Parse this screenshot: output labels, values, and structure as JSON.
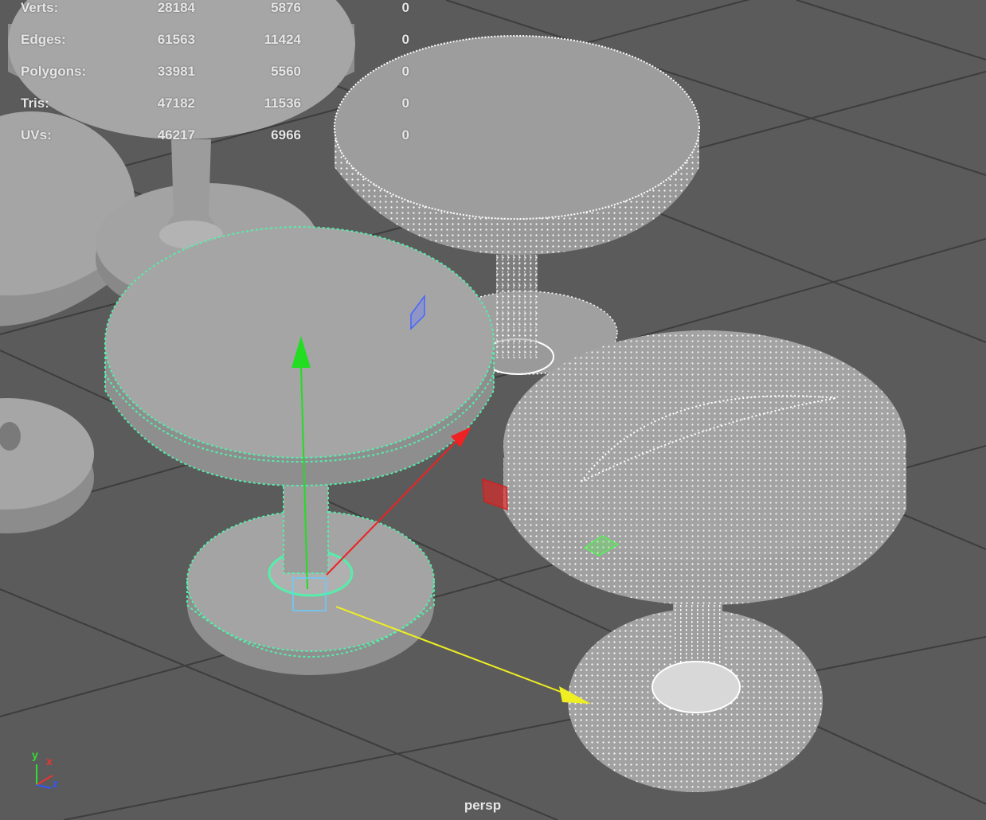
{
  "viewport": {
    "camera": "persp",
    "background": "#5b5b5b",
    "grid_color": "#3d3d3d"
  },
  "heads_up_display": {
    "rows": [
      {
        "label": "Verts:",
        "values": [
          "28184",
          "5876",
          "0"
        ]
      },
      {
        "label": "Edges:",
        "values": [
          "61563",
          "11424",
          "0"
        ]
      },
      {
        "label": "Polygons:",
        "values": [
          "33981",
          "5560",
          "0"
        ]
      },
      {
        "label": "Tris:",
        "values": [
          "47182",
          "11536",
          "0"
        ]
      },
      {
        "label": "UVs:",
        "values": [
          "46217",
          "6966",
          "0"
        ]
      }
    ]
  },
  "axis_indicator": {
    "y": "y",
    "x": "x",
    "z": "z",
    "y_color": "#33dd33",
    "x_color": "#ee3333",
    "z_color": "#3355ff"
  },
  "colors": {
    "shaded_mesh": "#a8a8a8",
    "selected_wireframe": "#55eeaa",
    "wireframe": "#ffffff",
    "manip_x": "#ee2222",
    "manip_y": "#22dd22",
    "manip_z": "#eeee22",
    "manip_plane_xy": "#4466ff",
    "manip_center": "#66ccff"
  },
  "objects": [
    "stool-shaded-back",
    "stool-shaded-left",
    "stool-shaded-left-bottom",
    "stool-selected",
    "stool-wireframe-back",
    "stool-wireframe-front"
  ]
}
